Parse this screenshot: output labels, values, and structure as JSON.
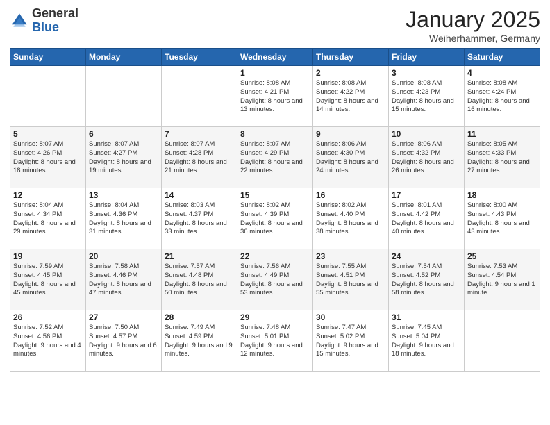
{
  "logo": {
    "general": "General",
    "blue": "Blue"
  },
  "header": {
    "title": "January 2025",
    "subtitle": "Weiherhammer, Germany"
  },
  "weekdays": [
    "Sunday",
    "Monday",
    "Tuesday",
    "Wednesday",
    "Thursday",
    "Friday",
    "Saturday"
  ],
  "weeks": [
    [
      {
        "day": "",
        "info": ""
      },
      {
        "day": "",
        "info": ""
      },
      {
        "day": "",
        "info": ""
      },
      {
        "day": "1",
        "info": "Sunrise: 8:08 AM\nSunset: 4:21 PM\nDaylight: 8 hours\nand 13 minutes."
      },
      {
        "day": "2",
        "info": "Sunrise: 8:08 AM\nSunset: 4:22 PM\nDaylight: 8 hours\nand 14 minutes."
      },
      {
        "day": "3",
        "info": "Sunrise: 8:08 AM\nSunset: 4:23 PM\nDaylight: 8 hours\nand 15 minutes."
      },
      {
        "day": "4",
        "info": "Sunrise: 8:08 AM\nSunset: 4:24 PM\nDaylight: 8 hours\nand 16 minutes."
      }
    ],
    [
      {
        "day": "5",
        "info": "Sunrise: 8:07 AM\nSunset: 4:26 PM\nDaylight: 8 hours\nand 18 minutes."
      },
      {
        "day": "6",
        "info": "Sunrise: 8:07 AM\nSunset: 4:27 PM\nDaylight: 8 hours\nand 19 minutes."
      },
      {
        "day": "7",
        "info": "Sunrise: 8:07 AM\nSunset: 4:28 PM\nDaylight: 8 hours\nand 21 minutes."
      },
      {
        "day": "8",
        "info": "Sunrise: 8:07 AM\nSunset: 4:29 PM\nDaylight: 8 hours\nand 22 minutes."
      },
      {
        "day": "9",
        "info": "Sunrise: 8:06 AM\nSunset: 4:30 PM\nDaylight: 8 hours\nand 24 minutes."
      },
      {
        "day": "10",
        "info": "Sunrise: 8:06 AM\nSunset: 4:32 PM\nDaylight: 8 hours\nand 26 minutes."
      },
      {
        "day": "11",
        "info": "Sunrise: 8:05 AM\nSunset: 4:33 PM\nDaylight: 8 hours\nand 27 minutes."
      }
    ],
    [
      {
        "day": "12",
        "info": "Sunrise: 8:04 AM\nSunset: 4:34 PM\nDaylight: 8 hours\nand 29 minutes."
      },
      {
        "day": "13",
        "info": "Sunrise: 8:04 AM\nSunset: 4:36 PM\nDaylight: 8 hours\nand 31 minutes."
      },
      {
        "day": "14",
        "info": "Sunrise: 8:03 AM\nSunset: 4:37 PM\nDaylight: 8 hours\nand 33 minutes."
      },
      {
        "day": "15",
        "info": "Sunrise: 8:02 AM\nSunset: 4:39 PM\nDaylight: 8 hours\nand 36 minutes."
      },
      {
        "day": "16",
        "info": "Sunrise: 8:02 AM\nSunset: 4:40 PM\nDaylight: 8 hours\nand 38 minutes."
      },
      {
        "day": "17",
        "info": "Sunrise: 8:01 AM\nSunset: 4:42 PM\nDaylight: 8 hours\nand 40 minutes."
      },
      {
        "day": "18",
        "info": "Sunrise: 8:00 AM\nSunset: 4:43 PM\nDaylight: 8 hours\nand 43 minutes."
      }
    ],
    [
      {
        "day": "19",
        "info": "Sunrise: 7:59 AM\nSunset: 4:45 PM\nDaylight: 8 hours\nand 45 minutes."
      },
      {
        "day": "20",
        "info": "Sunrise: 7:58 AM\nSunset: 4:46 PM\nDaylight: 8 hours\nand 47 minutes."
      },
      {
        "day": "21",
        "info": "Sunrise: 7:57 AM\nSunset: 4:48 PM\nDaylight: 8 hours\nand 50 minutes."
      },
      {
        "day": "22",
        "info": "Sunrise: 7:56 AM\nSunset: 4:49 PM\nDaylight: 8 hours\nand 53 minutes."
      },
      {
        "day": "23",
        "info": "Sunrise: 7:55 AM\nSunset: 4:51 PM\nDaylight: 8 hours\nand 55 minutes."
      },
      {
        "day": "24",
        "info": "Sunrise: 7:54 AM\nSunset: 4:52 PM\nDaylight: 8 hours\nand 58 minutes."
      },
      {
        "day": "25",
        "info": "Sunrise: 7:53 AM\nSunset: 4:54 PM\nDaylight: 9 hours\nand 1 minute."
      }
    ],
    [
      {
        "day": "26",
        "info": "Sunrise: 7:52 AM\nSunset: 4:56 PM\nDaylight: 9 hours\nand 4 minutes."
      },
      {
        "day": "27",
        "info": "Sunrise: 7:50 AM\nSunset: 4:57 PM\nDaylight: 9 hours\nand 6 minutes."
      },
      {
        "day": "28",
        "info": "Sunrise: 7:49 AM\nSunset: 4:59 PM\nDaylight: 9 hours\nand 9 minutes."
      },
      {
        "day": "29",
        "info": "Sunrise: 7:48 AM\nSunset: 5:01 PM\nDaylight: 9 hours\nand 12 minutes."
      },
      {
        "day": "30",
        "info": "Sunrise: 7:47 AM\nSunset: 5:02 PM\nDaylight: 9 hours\nand 15 minutes."
      },
      {
        "day": "31",
        "info": "Sunrise: 7:45 AM\nSunset: 5:04 PM\nDaylight: 9 hours\nand 18 minutes."
      },
      {
        "day": "",
        "info": ""
      }
    ]
  ]
}
